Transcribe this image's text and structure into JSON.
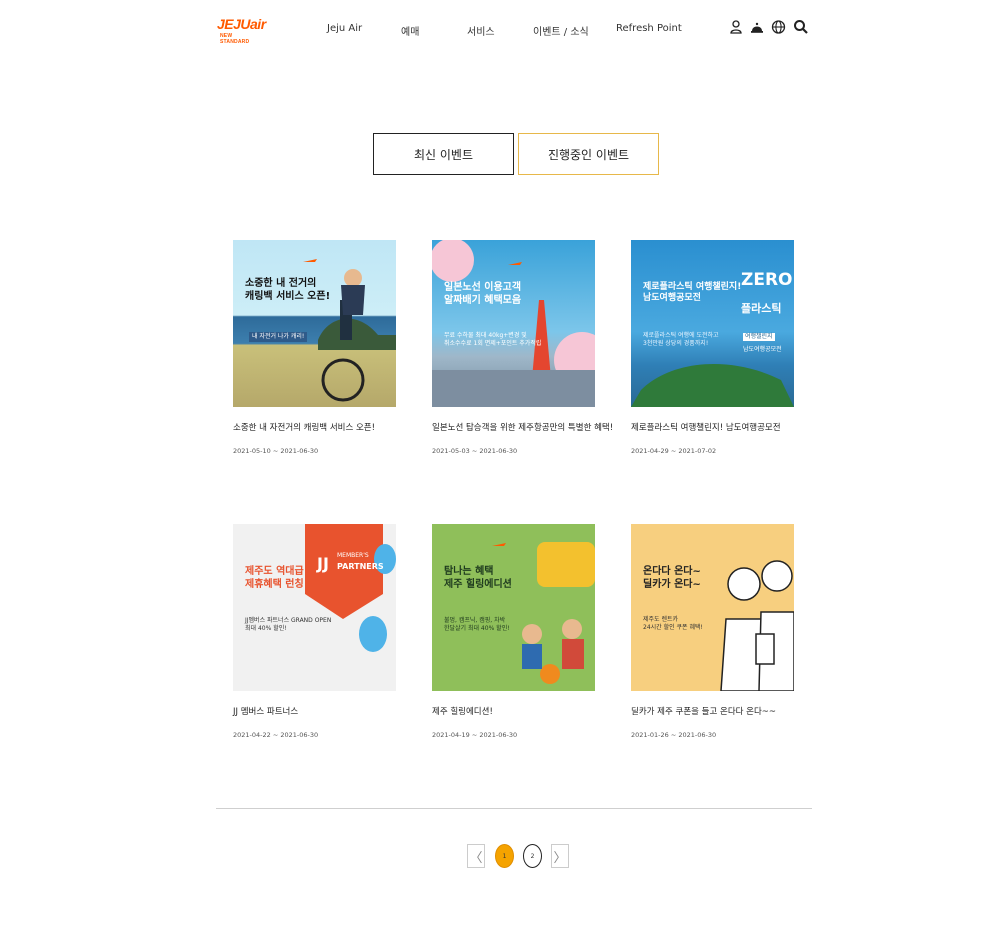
{
  "brand": {
    "logo_main": "JEJUair",
    "logo_sub": "NEW STANDARD",
    "color": "#ff5a00"
  },
  "nav": [
    "Jeju Air",
    "예매",
    "서비스",
    "이벤트 / 소식",
    "Refresh Point"
  ],
  "header_icons": [
    "user-icon",
    "service-bell-icon",
    "globe-icon",
    "search-icon"
  ],
  "tabs": {
    "latest": "최신 이벤트",
    "ongoing": "진행중인 이벤트"
  },
  "events": [
    {
      "title": "소중한 내 자전거의 캐링백 서비스 오픈!",
      "date": "2021-05-10 ~ 2021-06-30",
      "banner": {
        "heading": "소중한 내 전거의\n캐링백 서비스 오픈!",
        "sub": "내 자전거 나가 캐리!"
      }
    },
    {
      "title": "일본노선 탑승객을 위한 제주항공만의 특별한 혜택!",
      "date": "2021-05-03 ~ 2021-06-30",
      "banner": {
        "heading": "일본노선 이용고객\n알짜배기 혜택모음",
        "sub": "무료 수하물 최대 40kg+변경 및\n취소수수료 1회 면제+포인트 추가적립"
      }
    },
    {
      "title": "제로플라스틱 여행챌린지! 남도여행공모전",
      "date": "2021-04-29 ~ 2021-07-02",
      "banner": {
        "heading": "제로플라스틱 여행챌린지!\n남도여행공모전",
        "sub": "제로플라스틱 여행에 도전하고\n3천만원 상당의 경품까지!",
        "side1": "ZERO",
        "side2": "플라스틱",
        "side3": "여행챌린지",
        "side4": "남도여행공모전"
      }
    },
    {
      "title": "JJ 멤버스 파트너스",
      "date": "2021-04-22 ~ 2021-06-30",
      "banner": {
        "heading": "제주도 역대급\n제휴혜택 런칭",
        "sub": "JJ멤버스 파트너스 GRAND OPEN\n최대 40% 할인!",
        "badge1": "MEMBER'S",
        "badge2": "PARTNERS",
        "jj": "JJ"
      }
    },
    {
      "title": "제주 힐링에디션!",
      "date": "2021-04-19 ~ 2021-06-30",
      "banner": {
        "heading": "탐나는 혜택\n제주 힐링에디션",
        "sub": "불멍, 캠프닉, 캠핑, 차박\n한달살기 최대 40% 할인!"
      }
    },
    {
      "title": "딜카가 제주 쿠폰을 들고 온다다 온다~~",
      "date": "2021-01-26 ~ 2021-06-30",
      "banner": {
        "heading": "온다다 온다~\n딜카가 온다~",
        "sub": "제주도 렌트카\n24시간 할인 쿠폰 혜택!"
      }
    }
  ],
  "pagination": {
    "prev": "〈",
    "pages": [
      "1",
      "2"
    ],
    "next": "〉",
    "current": "1"
  },
  "colors": {
    "accent": "#f5a300",
    "tab_active_border": "#e7b84a"
  }
}
